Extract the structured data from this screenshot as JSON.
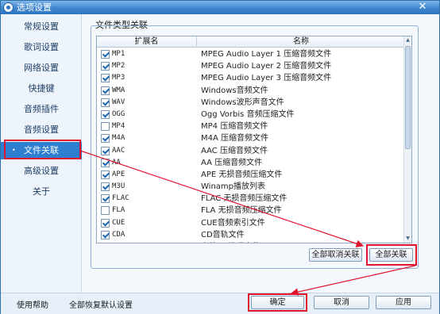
{
  "window": {
    "title": "选项设置",
    "close_label": "✕"
  },
  "sidebar": {
    "items": [
      {
        "label": "常规设置"
      },
      {
        "label": "歌词设置"
      },
      {
        "label": "网络设置"
      },
      {
        "label": "快捷键"
      },
      {
        "label": "音频插件"
      },
      {
        "label": "音频设置"
      },
      {
        "label": "文件关联",
        "active": true
      },
      {
        "label": "高级设置"
      },
      {
        "label": "关于"
      }
    ],
    "active_bullet": "•"
  },
  "group": {
    "title": "文件类型关联"
  },
  "list": {
    "headers": {
      "ext": "扩展名",
      "name": "名称"
    },
    "rows": [
      {
        "ext": "MP1",
        "name": "MPEG Audio Layer 1 压缩音频文件",
        "checked": true
      },
      {
        "ext": "MP2",
        "name": "MPEG Audio Layer 2 压缩音频文件",
        "checked": true
      },
      {
        "ext": "MP3",
        "name": "MPEG Audio Layer 3 压缩音频文件",
        "checked": true
      },
      {
        "ext": "WMA",
        "name": "Windows音频文件",
        "checked": true
      },
      {
        "ext": "WAV",
        "name": "Windows波形声音文件",
        "checked": true
      },
      {
        "ext": "OGG",
        "name": "Ogg Vorbis 音频压缩文件",
        "checked": true
      },
      {
        "ext": "MP4",
        "name": "MP4 压缩音频文件",
        "checked": false
      },
      {
        "ext": "M4A",
        "name": "M4A 压缩音频文件",
        "checked": true
      },
      {
        "ext": "AAC",
        "name": "AAC 压缩音频文件",
        "checked": true
      },
      {
        "ext": "AA",
        "name": "AA 压缩音频文件",
        "checked": true
      },
      {
        "ext": "APE",
        "name": "APE 无损音频压缩文件",
        "checked": true
      },
      {
        "ext": "M3U",
        "name": "Winamp播放列表",
        "checked": true
      },
      {
        "ext": "FLAC",
        "name": "FLAC 无损音频压缩文件",
        "checked": true
      },
      {
        "ext": "FLA",
        "name": "FLA 无损音频压缩文件",
        "checked": false
      },
      {
        "ext": "CUE",
        "name": "CUE音频索引文件",
        "checked": true
      },
      {
        "ext": "CDA",
        "name": "CD音轨文件",
        "checked": true
      },
      {
        "ext": "KRC",
        "name": "卡拉OK歌词文件",
        "checked": true
      }
    ]
  },
  "buttons": {
    "clear_all": "全部取消关联",
    "select_all": "全部关联",
    "ok": "确定",
    "cancel": "取消",
    "apply": "应用"
  },
  "footer": {
    "help": "使用帮助",
    "restore_defaults": "全部恢复默认设置"
  },
  "colors": {
    "title_bar": "#3f86cf",
    "active_item": "#2f7fd0",
    "annotation": "#e0152d"
  },
  "icons": [
    "app-icon",
    "close-icon",
    "checkbox-icon",
    "scroll-up-icon",
    "scroll-down-icon"
  ]
}
